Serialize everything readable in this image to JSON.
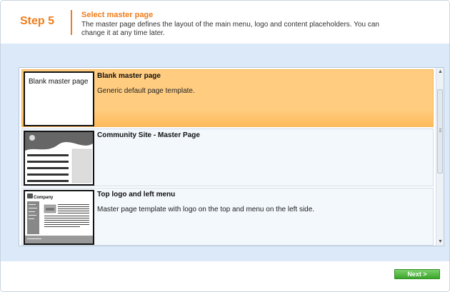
{
  "header": {
    "step": "Step 5",
    "title": "Select master page",
    "description": "The master page defines the layout of the main menu, logo and content placeholders. You can change it at any time later."
  },
  "templates": [
    {
      "name": "Blank master page",
      "description": "Generic default page template.",
      "thumb_label": "Blank master page",
      "selected": true
    },
    {
      "name": "Community Site - Master Page",
      "description": "",
      "selected": false
    },
    {
      "name": "Top logo and left menu",
      "description": "Master page template with logo on the top and menu on the left side.",
      "thumb_brand": "Company",
      "selected": false
    }
  ],
  "footer": {
    "next_label": "Next >"
  },
  "colors": {
    "accent": "#f07d1c",
    "selected_bg": "#ffcc80",
    "band_bg": "#dce9f8",
    "next_bg": "#3ba52c"
  }
}
